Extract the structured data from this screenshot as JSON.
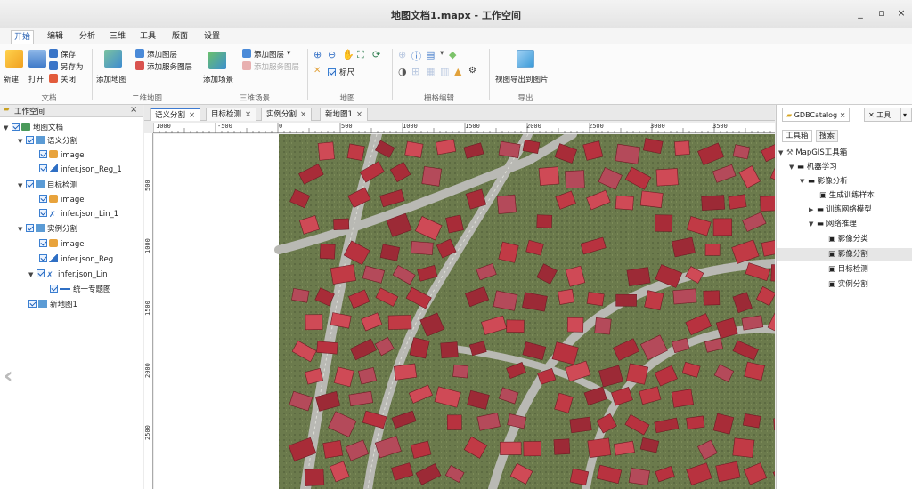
{
  "window": {
    "title": "地图文档1.mapx - 工作空间",
    "btn_min": "_",
    "btn_max": "▫",
    "btn_close": "×"
  },
  "menus": [
    "开始",
    "编辑",
    "分析",
    "三维",
    "工具",
    "版面",
    "设置"
  ],
  "ribbon": {
    "doc": {
      "new": "新建",
      "open": "打开",
      "save": "保存",
      "save_as": "另存为",
      "close": "关闭",
      "label": "文档"
    },
    "map2d": {
      "add_map": "添加地图",
      "add_layer": "添加图层",
      "add_service_layer": "添加服务图层",
      "label": "二维地图"
    },
    "scene3d": {
      "add_scene": "添加场景",
      "add_layer": "添加图层",
      "add_service_layer": "添加服务图层",
      "label": "三维场景"
    },
    "map": {
      "ruler": "标尺",
      "label": "地图"
    },
    "raster": {
      "label": "栅格编辑"
    },
    "export": {
      "export_image": "视图导出到图片",
      "label": "导出"
    }
  },
  "workspace": {
    "title": "工作空间",
    "root": "地图文档",
    "items": [
      {
        "name": "语义分割",
        "children": [
          "image",
          "infer.json_Reg_1"
        ]
      },
      {
        "name": "目标检测",
        "children": [
          "image",
          "infer.json_Lin_1"
        ]
      },
      {
        "name": "实例分割",
        "children": [
          "image",
          "infer.json_Reg",
          "infer.json_Lin"
        ]
      },
      {
        "name": "统一专题图"
      },
      {
        "name": "新地图1"
      }
    ]
  },
  "tabs": [
    {
      "label": "语义分割",
      "close": "×"
    },
    {
      "label": "目标检测",
      "close": "×"
    },
    {
      "label": "实例分割",
      "close": "×"
    },
    {
      "label": "新地图1",
      "close": "×"
    }
  ],
  "ruler": {
    "h": [
      "1000",
      "-500",
      "0",
      "500",
      "1000",
      "1500",
      "2000",
      "2500",
      "3000",
      "3500"
    ],
    "v": [
      "500",
      "1000",
      "1500",
      "2000",
      "2500"
    ]
  },
  "right_panel": {
    "tab1": "GDBCatalog",
    "tab2": "工具",
    "sub_tabs": [
      "工具箱",
      "搜索"
    ],
    "tree": {
      "root": "MapGIS工具箱",
      "ml": "机器学习",
      "image_analysis": "影像分析",
      "gen_samples": "生成训练样本",
      "train_model": "训练网络模型",
      "inference": "网络推理",
      "items": [
        "影像分类",
        "影像分割",
        "目标检测",
        "实例分割"
      ]
    }
  },
  "colors": {
    "accent": "#3d7ad1",
    "roof": "#b8323f",
    "grass": "#6b7a4c"
  }
}
